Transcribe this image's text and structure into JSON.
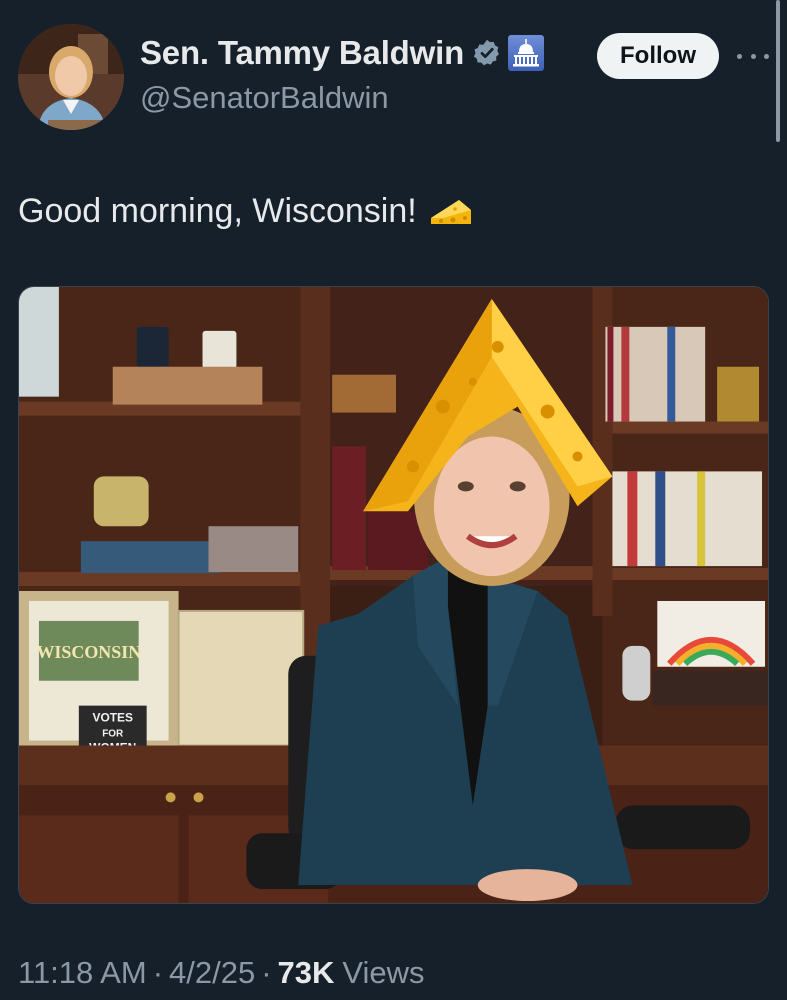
{
  "author": {
    "display_name": "Sen. Tammy Baldwin",
    "handle": "@SenatorBaldwin",
    "verified_color": "#829aab",
    "affiliation_badge": "capitol-icon"
  },
  "header": {
    "follow_label": "Follow",
    "more_icon": "more-horizontal-icon"
  },
  "tweet": {
    "text": "Good morning, Wisconsin!",
    "emoji": "cheese-wedge-icon"
  },
  "media": {
    "sign_text_line1": "VOTES",
    "sign_text_line2": "FOR",
    "sign_text_line3": "WOMEN",
    "postcard_text": "WISCONSIN"
  },
  "meta": {
    "time": "11:18 AM",
    "date": "4/2/25",
    "separator": "·",
    "views_count": "73K",
    "views_label": "Views"
  },
  "colors": {
    "background": "#15202b",
    "text_primary": "#e7e9ea",
    "text_secondary": "#8b98a5",
    "follow_bg": "#eff3f4"
  }
}
